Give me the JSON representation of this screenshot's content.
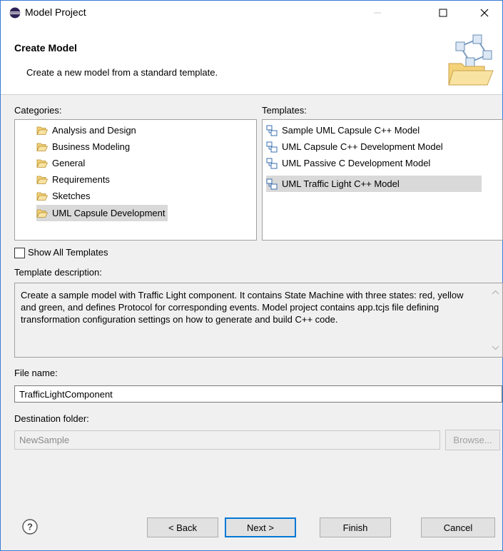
{
  "window": {
    "title": "Model Project"
  },
  "banner": {
    "heading": "Create Model",
    "description": "Create a new model from a standard template."
  },
  "categories": {
    "label": "Categories:",
    "items": [
      "Analysis and Design",
      "Business Modeling",
      "General",
      "Requirements",
      "Sketches",
      "UML Capsule Development"
    ],
    "selected": "UML Capsule Development"
  },
  "templates": {
    "label": "Templates:",
    "items": [
      "Sample UML Capsule C++ Model",
      "UML Capsule C++ Development Model",
      "UML Passive C Development Model",
      "UML Traffic Light C++ Model"
    ],
    "selected": "UML Traffic Light C++ Model"
  },
  "show_all": {
    "label": "Show All Templates",
    "checked": false
  },
  "description": {
    "label": "Template description:",
    "text": "Create a sample model with Traffic Light component. It contains State Machine with three states: red, yellow and green, and defines Protocol for corresponding events. Model project contains app.tcjs file defining transformation configuration settings on how to generate and build C++ code."
  },
  "file_name": {
    "label": "File name:",
    "value": "TrafficLightComponent"
  },
  "destination": {
    "label": "Destination folder:",
    "value": "NewSample",
    "browse_label": "Browse..."
  },
  "buttons": {
    "back": "< Back",
    "next": "Next >",
    "finish": "Finish",
    "cancel": "Cancel"
  },
  "colors": {
    "selection": "#d9d9d9",
    "default_button_border": "#0078d7",
    "folder": "#e8b84a"
  },
  "icons": {
    "app": "eclipse-icon",
    "banner": "new-model-wizard-icon",
    "category": "folder-open-icon",
    "template": "model-template-icon",
    "help": "help-icon"
  }
}
